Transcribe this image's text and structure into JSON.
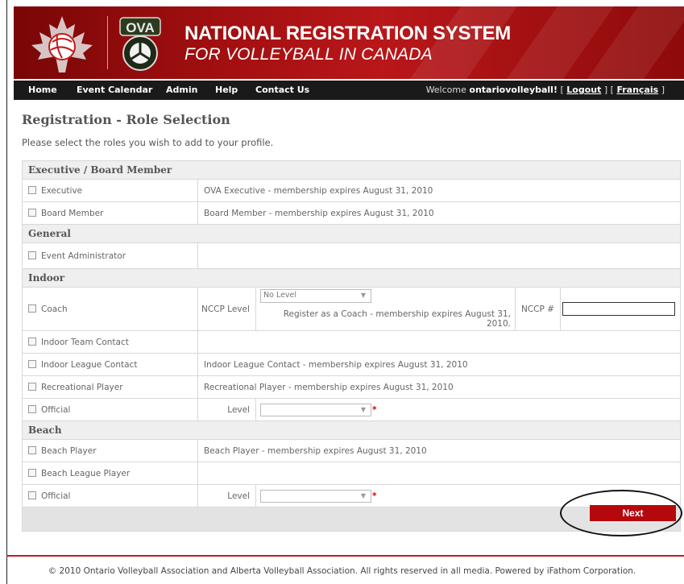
{
  "header": {
    "title_line1": "NATIONAL REGISTRATION SYSTEM",
    "title_line2": "FOR VOLLEYBALL IN CANADA",
    "logo_text": "OVA"
  },
  "nav": {
    "items": [
      "Home",
      "Event Calendar",
      "Admin",
      "Help",
      "Contact Us"
    ],
    "welcome_prefix": "Welcome",
    "username": "ontariovolleyball!",
    "logout_label": "Logout",
    "language_label": "Français"
  },
  "page": {
    "title": "Registration - Role Selection",
    "intro": "Please select the roles you wish to add to your profile."
  },
  "sections": {
    "executive": {
      "heading": "Executive / Board Member",
      "executive_label": "Executive",
      "executive_desc": "OVA Executive - membership expires August 31, 2010",
      "board_label": "Board Member",
      "board_desc": "Board Member - membership expires August 31, 2010"
    },
    "general": {
      "heading": "General",
      "event_admin_label": "Event Administrator"
    },
    "indoor": {
      "heading": "Indoor",
      "coach_label": "Coach",
      "nccp_level_label": "NCCP Level",
      "nccp_level_value": "No Level",
      "coach_desc": "Register as a Coach - membership expires August 31, 2010.",
      "nccp_number_label": "NCCP #",
      "nccp_number_value": "",
      "team_contact_label": "Indoor Team Contact",
      "league_contact_label": "Indoor League Contact",
      "league_contact_desc": "Indoor League Contact - membership expires August 31, 2010",
      "rec_player_label": "Recreational Player",
      "rec_player_desc": "Recreational Player - membership expires August 31, 2010",
      "official_label": "Official",
      "official_level_label": "Level",
      "official_level_value": ""
    },
    "beach": {
      "heading": "Beach",
      "player_label": "Beach Player",
      "player_desc": "Beach Player - membership expires August 31, 2010",
      "league_player_label": "Beach League Player",
      "official_label": "Official",
      "official_level_label": "Level",
      "official_level_value": ""
    }
  },
  "actions": {
    "next_label": "Next"
  },
  "footer": {
    "text": "© 2010 Ontario Volleyball Association and Alberta Volleyball Association. All rights reserved in all media. Powered by iFathom Corporation."
  },
  "colors": {
    "brand_red": "#b5080d",
    "nav_bg": "#1a1a1a",
    "section_bg": "#efefef"
  }
}
